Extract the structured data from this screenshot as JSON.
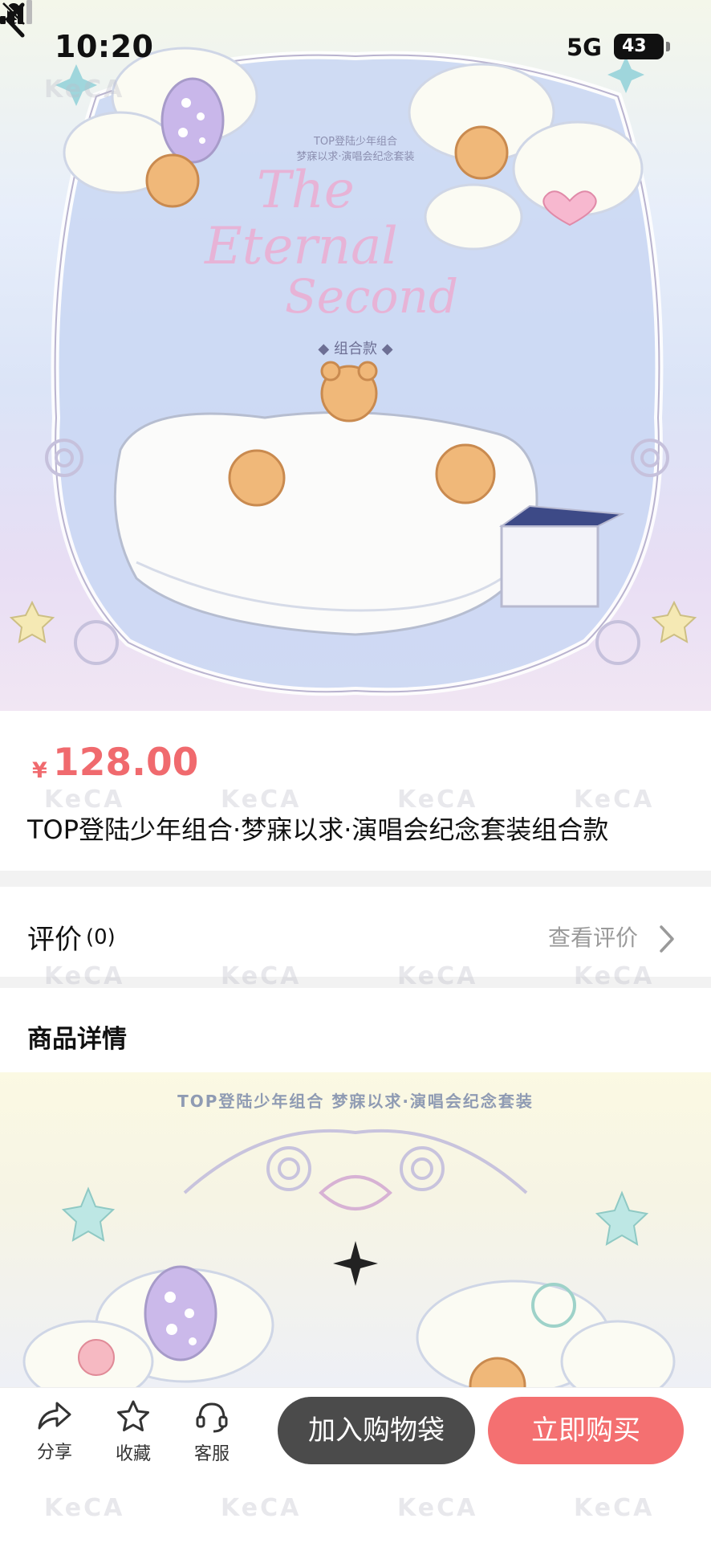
{
  "status_bar": {
    "time": "10:20",
    "network": "5G",
    "battery": "43",
    "icons": [
      "bell-muted-icon",
      "signal-bars-icon",
      "battery-icon"
    ]
  },
  "nav": {
    "back_icon": "chevron-left-icon"
  },
  "hero_art": {
    "small_caption_1": "TOP登陆少年组合",
    "small_caption_2": "梦寐以求·演唱会纪念套装",
    "title_line_1": "The",
    "title_line_2": "Eternal",
    "title_line_3": "Second",
    "edition": "◆ 组合款 ◆"
  },
  "product": {
    "currency": "¥",
    "price": "128.00",
    "title": "TOP登陆少年组合·梦寐以求·演唱会纪念套装组合款"
  },
  "reviews": {
    "label": "评价",
    "count": "(0)",
    "view_link": "查看评价"
  },
  "details": {
    "heading": "商品详情",
    "image_caption": "TOP登陆少年组合 梦寐以求·演唱会纪念套装"
  },
  "bottom_bar": {
    "share": "分享",
    "favorite": "收藏",
    "service": "客服",
    "add_to_bag": "加入购物袋",
    "buy_now": "立即购买"
  },
  "watermark": "KeCA",
  "colors": {
    "price": "#f06a6e",
    "buy_button": "#f47071",
    "cart_button": "#4b4b4b"
  }
}
